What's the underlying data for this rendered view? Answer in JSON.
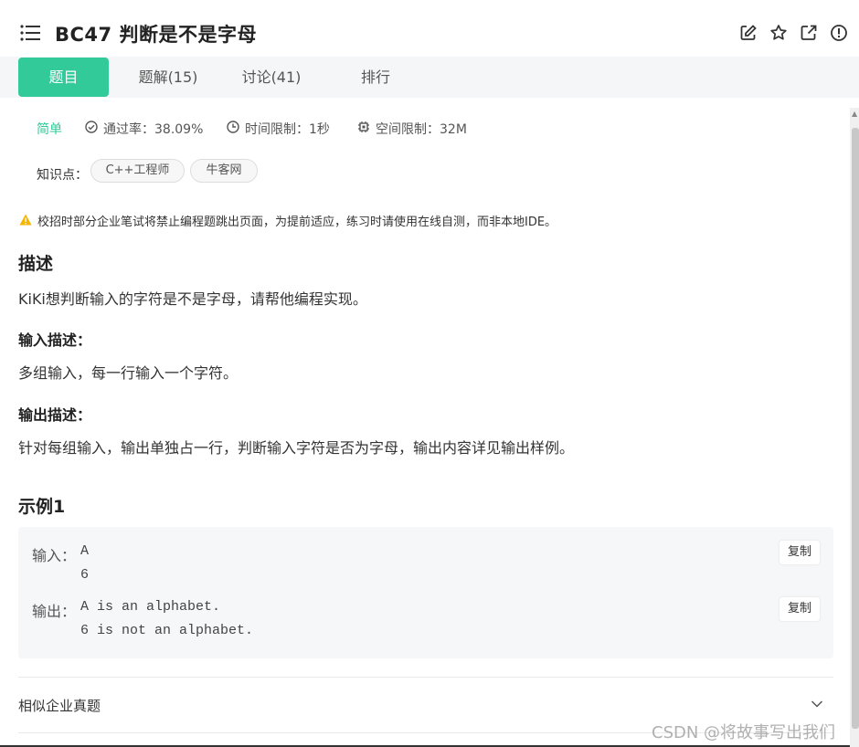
{
  "header": {
    "title": "BC47  判断是不是字母",
    "icons": [
      "list-icon",
      "edit-icon",
      "star-icon",
      "external-link-icon",
      "alert-icon"
    ]
  },
  "tabs": [
    {
      "label": "题目",
      "active": true
    },
    {
      "label": "题解(15)",
      "active": false
    },
    {
      "label": "讨论(41)",
      "active": false
    },
    {
      "label": "排行",
      "active": false
    }
  ],
  "meta": {
    "difficulty": "简单",
    "pass_rate": "通过率：38.09%",
    "time_limit": "时间限制：1秒",
    "memory_limit": "空间限制：32M"
  },
  "knowledge": {
    "label": "知识点：",
    "tags": [
      "C++工程师",
      "牛客网"
    ]
  },
  "warning": "校招时部分企业笔试将禁止编程题跳出页面，为提前适应，练习时请使用在线自测，而非本地IDE。",
  "description": {
    "heading": "描述",
    "text": "KiKi想判断输入的字符是不是字母，请帮他编程实现。"
  },
  "input_desc": {
    "heading": "输入描述：",
    "text": "多组输入，每一行输入一个字符。"
  },
  "output_desc": {
    "heading": "输出描述：",
    "text": "针对每组输入，输出单独占一行，判断输入字符是否为字母，输出内容详见输出样例。"
  },
  "example": {
    "heading": "示例1",
    "input_label": "输入：",
    "input_value": "A\n6",
    "output_label": "输出：",
    "output_value": "A is an alphabet.\n6 is not an alphabet.",
    "copy_label": "复制"
  },
  "similar": {
    "label": "相似企业真题"
  },
  "watermark": "CSDN @将故事写出我们",
  "colors": {
    "accent": "#32ca99",
    "warning": "#f5b400"
  }
}
